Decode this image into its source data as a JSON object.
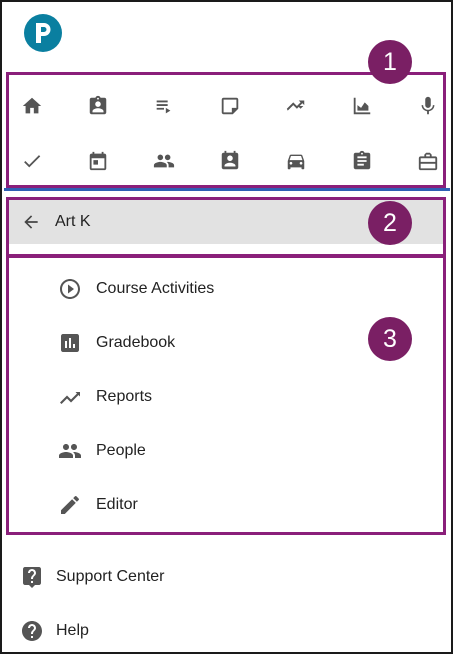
{
  "badges": {
    "one": "1",
    "two": "2",
    "three": "3"
  },
  "back_bar": {
    "label": "Art K"
  },
  "top_icons": [
    "home-icon",
    "assignment-ind-icon",
    "playlist-play-icon",
    "note-icon",
    "trending-icon",
    "area-chart-icon",
    "mic-icon",
    "check-icon",
    "calendar-icon",
    "people-icon",
    "contact-badge-icon",
    "car-icon",
    "clipboard-icon",
    "briefcase-icon"
  ],
  "course_menu": {
    "items": [
      {
        "label": "Course Activities",
        "icon": "play-circle-icon"
      },
      {
        "label": "Gradebook",
        "icon": "bar-chart-icon"
      },
      {
        "label": "Reports",
        "icon": "trending-icon"
      },
      {
        "label": "People",
        "icon": "people-icon"
      },
      {
        "label": "Editor",
        "icon": "pencil-icon"
      }
    ]
  },
  "footer_menu": {
    "items": [
      {
        "label": "Support Center",
        "icon": "support-icon"
      },
      {
        "label": "Help",
        "icon": "help-icon"
      }
    ]
  },
  "colors": {
    "highlight": "#8a1f7a",
    "badge": "#7a1f64",
    "logo": "#0a7fa0",
    "divider": "#2f5fb4"
  }
}
